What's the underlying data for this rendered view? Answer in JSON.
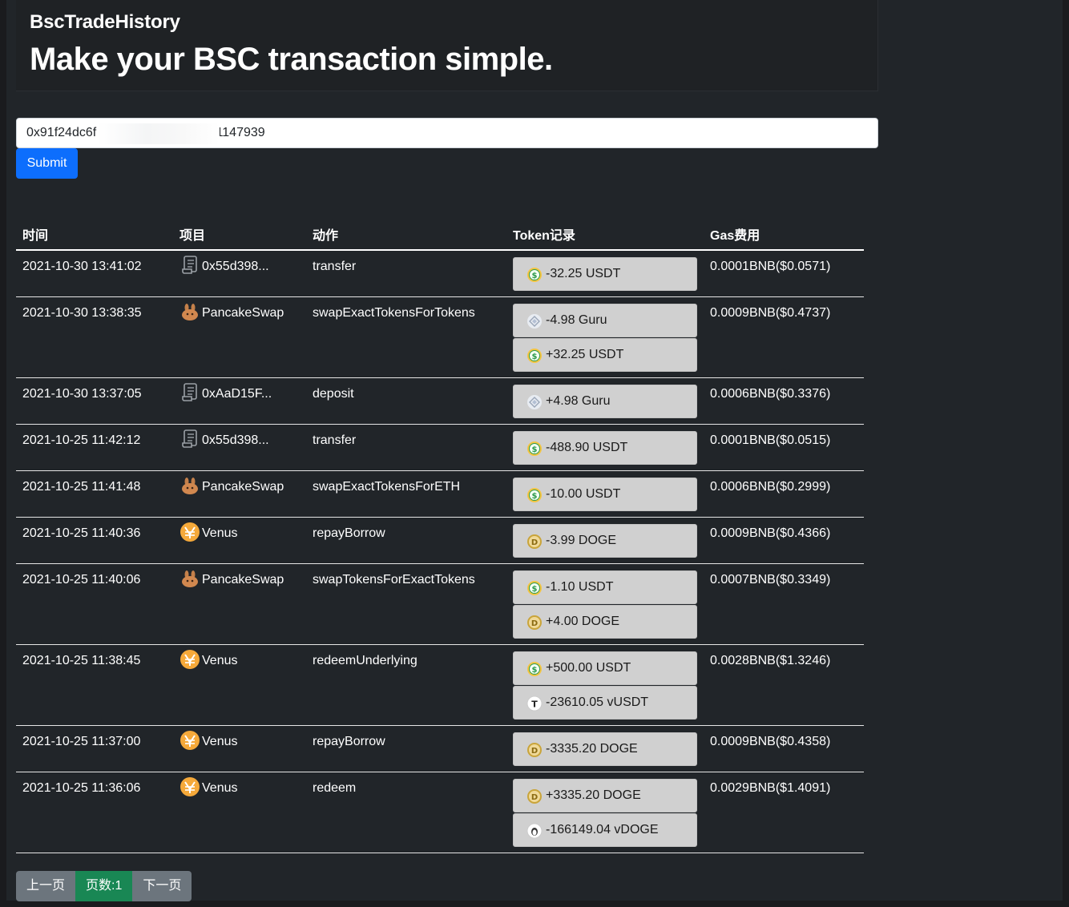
{
  "header": {
    "brand": "BscTradeHistory",
    "tagline": "Make your BSC transaction simple."
  },
  "search": {
    "value": "0x91f24dc6f                      18c5c21147939",
    "submit_label": "Submit"
  },
  "table": {
    "headers": [
      "时间",
      "项目",
      "动作",
      "Token记录",
      "Gas费用"
    ],
    "rows": [
      {
        "time": "2021-10-30 13:41:02",
        "project": "0x55d398...",
        "project_icon": "contract-icon",
        "action": "transfer",
        "tokens": [
          {
            "icon": "usdt-icon",
            "text": "-32.25 USDT"
          }
        ],
        "gas": "0.0001BNB($0.0571)"
      },
      {
        "time": "2021-10-30 13:38:35",
        "project": "PancakeSwap",
        "project_icon": "pancakeswap-icon",
        "action": "swapExactTokensForTokens",
        "tokens": [
          {
            "icon": "guru-icon",
            "text": "-4.98 Guru"
          },
          {
            "icon": "usdt-icon",
            "text": "+32.25 USDT"
          }
        ],
        "gas": "0.0009BNB($0.4737)"
      },
      {
        "time": "2021-10-30 13:37:05",
        "project": "0xAaD15F...",
        "project_icon": "contract-icon",
        "action": "deposit",
        "tokens": [
          {
            "icon": "guru-icon",
            "text": "+4.98 Guru"
          }
        ],
        "gas": "0.0006BNB($0.3376)"
      },
      {
        "time": "2021-10-25 11:42:12",
        "project": "0x55d398...",
        "project_icon": "contract-icon",
        "action": "transfer",
        "tokens": [
          {
            "icon": "usdt-icon",
            "text": "-488.90 USDT"
          }
        ],
        "gas": "0.0001BNB($0.0515)"
      },
      {
        "time": "2021-10-25 11:41:48",
        "project": "PancakeSwap",
        "project_icon": "pancakeswap-icon",
        "action": "swapExactTokensForETH",
        "tokens": [
          {
            "icon": "usdt-icon",
            "text": "-10.00 USDT"
          }
        ],
        "gas": "0.0006BNB($0.2999)"
      },
      {
        "time": "2021-10-25 11:40:36",
        "project": "Venus",
        "project_icon": "venus-icon",
        "action": "repayBorrow",
        "tokens": [
          {
            "icon": "doge-icon",
            "text": "-3.99 DOGE"
          }
        ],
        "gas": "0.0009BNB($0.4366)"
      },
      {
        "time": "2021-10-25 11:40:06",
        "project": "PancakeSwap",
        "project_icon": "pancakeswap-icon",
        "action": "swapTokensForExactTokens",
        "tokens": [
          {
            "icon": "usdt-icon",
            "text": "-1.10 USDT"
          },
          {
            "icon": "doge-icon",
            "text": "+4.00 DOGE"
          }
        ],
        "gas": "0.0007BNB($0.3349)"
      },
      {
        "time": "2021-10-25 11:38:45",
        "project": "Venus",
        "project_icon": "venus-icon",
        "action": "redeemUnderlying",
        "tokens": [
          {
            "icon": "usdt-icon",
            "text": "+500.00 USDT"
          },
          {
            "icon": "vusdt-icon",
            "text": "-23610.05 vUSDT"
          }
        ],
        "gas": "0.0028BNB($1.3246)"
      },
      {
        "time": "2021-10-25 11:37:00",
        "project": "Venus",
        "project_icon": "venus-icon",
        "action": "repayBorrow",
        "tokens": [
          {
            "icon": "doge-icon",
            "text": "-3335.20 DOGE"
          }
        ],
        "gas": "0.0009BNB($0.4358)"
      },
      {
        "time": "2021-10-25 11:36:06",
        "project": "Venus",
        "project_icon": "venus-icon",
        "action": "redeem",
        "tokens": [
          {
            "icon": "doge-icon",
            "text": "+3335.20 DOGE"
          },
          {
            "icon": "vdoge-icon",
            "text": "-166149.04 vDOGE"
          }
        ],
        "gas": "0.0029BNB($1.4091)"
      }
    ]
  },
  "pagination": {
    "prev_label": "上一页",
    "current_label": "页数:1",
    "next_label": "下一页"
  },
  "colors": {
    "background": "#212529",
    "submit": "#0d6efd",
    "pager_nav": "#6c757d",
    "pager_current": "#198754",
    "token_chip": "#d0d0d0"
  }
}
